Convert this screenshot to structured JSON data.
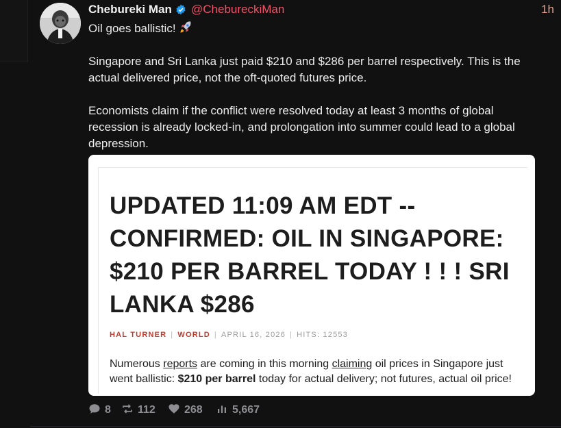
{
  "post": {
    "author_name": "Chebureki Man",
    "author_handle": "@ChebureckiMan",
    "time_ago": "1h",
    "text_line1": "Oil goes ballistic!",
    "text_para2": "Singapore and Sri Lanka just paid $210 and $286 per barrel respectively. This is the actual delivered price, not the oft-quoted futures price.",
    "text_para3": "Economists claim if the conflict were resolved today at least 3 months of global recession is already locked-in, and prolongation into summer could lead to a global depression."
  },
  "article_card": {
    "headline": "UPDATED 11:09 AM EDT -- CONFIRMED: OIL IN SINGAPORE: $210 PER BARREL TODAY ! ! ! SRI LANKA $286",
    "author": "HAL TURNER",
    "category": "WORLD",
    "date": "APRIL 16, 2026",
    "hits": "HITS: 12553",
    "excerpt_1": "Numerous ",
    "excerpt_link1": "reports",
    "excerpt_2": " are coming in this morning ",
    "excerpt_link2": "claiming",
    "excerpt_3": " oil prices in Singapore just went ballistic: ",
    "excerpt_bold": "$210 per barrel",
    "excerpt_4": " today for actual delivery; not futures, actual oil price!"
  },
  "actions": {
    "replies": "8",
    "reposts": "112",
    "likes": "268",
    "views": "5,667"
  },
  "colors": {
    "background": "#111112",
    "handle": "#f0546a",
    "verified": "#1d9bf0",
    "meta_accent": "#c0392b"
  },
  "icons": [
    "verified-badge-icon",
    "rocket-icon",
    "reply-icon",
    "repost-icon",
    "like-icon",
    "views-icon"
  ]
}
